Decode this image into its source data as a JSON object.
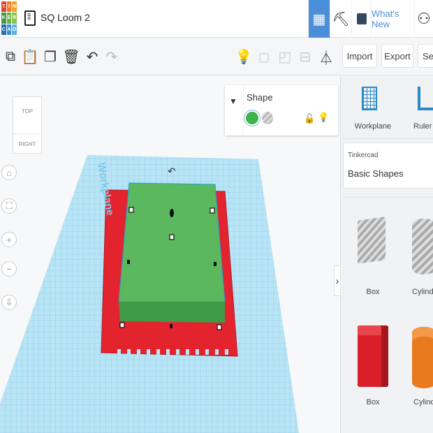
{
  "header": {
    "logo_letters": [
      "T",
      "I",
      "N",
      "K",
      "E",
      "R",
      "C",
      "A",
      "D"
    ],
    "title": "SQ Loom 2",
    "whats_new": "What's New",
    "nav_icons": [
      "3d-design-icon",
      "codeblocks-icon",
      "bricks-icon",
      "add-user-icon"
    ]
  },
  "toolbar": {
    "icons": [
      "copy-icon",
      "paste-icon",
      "duplicate-icon",
      "delete-icon",
      "undo-icon",
      "redo-icon",
      "light-icon",
      "group-icon",
      "ungroup-icon",
      "align-icon",
      "mirror-icon"
    ],
    "import": "Import",
    "export": "Export",
    "send": "Sen"
  },
  "viewcube": {
    "top": "TOP",
    "right": "RIGHT"
  },
  "workplane_label": "Workplane",
  "shape_panel": {
    "title": "Shape",
    "solid_color": "#3cb44b"
  },
  "right_panel": {
    "workplane": "Workplane",
    "ruler": "Ruler",
    "library_source": "Tinkercad",
    "library_name": "Basic Shapes",
    "shapes": [
      {
        "label": "Box",
        "style": "hole"
      },
      {
        "label": "Cylinder",
        "style": "hole"
      },
      {
        "label": "Box",
        "color": "#d9202a"
      },
      {
        "label": "Cylinder",
        "color": "#e87b1e"
      }
    ]
  },
  "colors": {
    "accent": "#4a8fd8",
    "grid": "#9fd8f0",
    "red_plate": "#e3242f",
    "green_box": "#55b35a"
  }
}
